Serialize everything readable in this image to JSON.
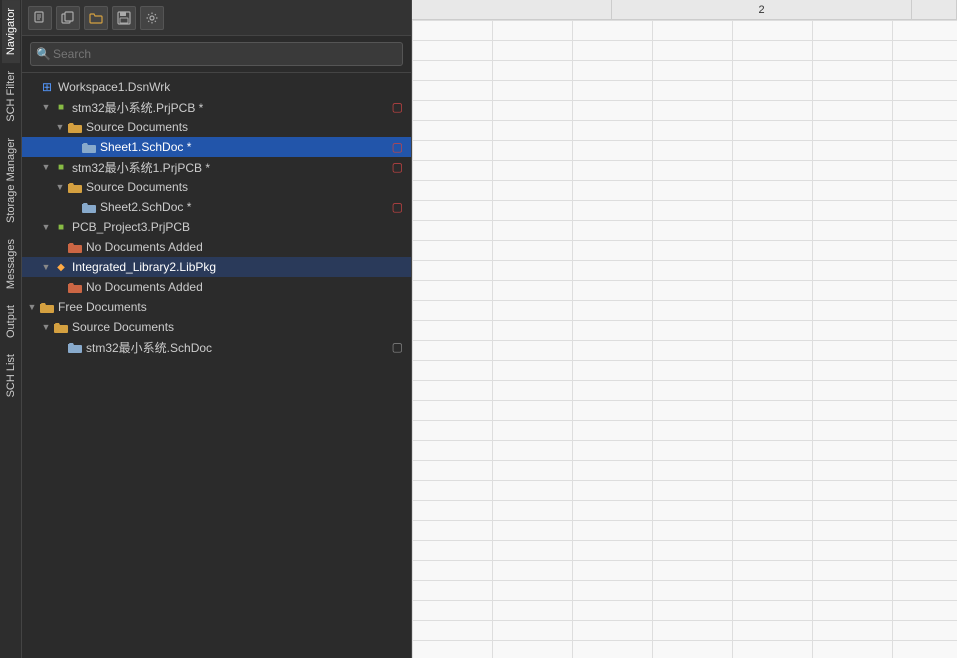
{
  "left_vtabs": [
    {
      "id": "navigator",
      "label": "Navigator"
    },
    {
      "id": "sch-filter",
      "label": "SCH Filter"
    },
    {
      "id": "storage-manager",
      "label": "Storage Manager"
    },
    {
      "id": "messages",
      "label": "Messages"
    },
    {
      "id": "output",
      "label": "Output"
    },
    {
      "id": "sch-list",
      "label": "SCH List"
    }
  ],
  "toolbar": {
    "buttons": [
      {
        "id": "btn1",
        "icon": "⊞",
        "tooltip": "New"
      },
      {
        "id": "btn2",
        "icon": "⧉",
        "tooltip": "Copy"
      },
      {
        "id": "btn3",
        "icon": "📂",
        "tooltip": "Open"
      },
      {
        "id": "btn4",
        "icon": "💾",
        "tooltip": "Save"
      },
      {
        "id": "btn5",
        "icon": "⚙",
        "tooltip": "Settings"
      }
    ]
  },
  "search": {
    "placeholder": "Search"
  },
  "tree": {
    "items": [
      {
        "id": "workspace",
        "level": 0,
        "type": "workspace",
        "label": "Workspace1.DsnWrk",
        "arrow": "empty",
        "modified": false
      },
      {
        "id": "proj1",
        "level": 1,
        "type": "project",
        "label": "stm32最小系统.PrjPCB *",
        "arrow": "expanded",
        "modified": true
      },
      {
        "id": "proj1-src",
        "level": 2,
        "type": "folder",
        "label": "Source Documents",
        "arrow": "expanded",
        "modified": false
      },
      {
        "id": "proj1-sheet1",
        "level": 3,
        "type": "schdoc",
        "label": "Sheet1.SchDoc *",
        "arrow": "empty",
        "modified": true,
        "selected": true
      },
      {
        "id": "proj2",
        "level": 1,
        "type": "project",
        "label": "stm32最小系统1.PrjPCB *",
        "arrow": "expanded",
        "modified": true
      },
      {
        "id": "proj2-src",
        "level": 2,
        "type": "folder",
        "label": "Source Documents",
        "arrow": "expanded",
        "modified": false
      },
      {
        "id": "proj2-sheet2",
        "level": 3,
        "type": "schdoc",
        "label": "Sheet2.SchDoc *",
        "arrow": "empty",
        "modified": true
      },
      {
        "id": "proj3",
        "level": 1,
        "type": "project-pcb",
        "label": "PCB_Project3.PrjPCB",
        "arrow": "expanded",
        "modified": false
      },
      {
        "id": "proj3-nodocs",
        "level": 2,
        "type": "nodocs",
        "label": "No Documents Added",
        "arrow": "empty",
        "modified": false
      },
      {
        "id": "libpkg",
        "level": 1,
        "type": "libpkg",
        "label": "Integrated_Library2.LibPkg",
        "arrow": "expanded",
        "modified": false,
        "highlighted": true
      },
      {
        "id": "libpkg-nodocs",
        "level": 2,
        "type": "nodocs",
        "label": "No Documents Added",
        "arrow": "empty",
        "modified": false
      },
      {
        "id": "freedocs",
        "level": 0,
        "type": "freedocs",
        "label": "Free Documents",
        "arrow": "expanded",
        "modified": false
      },
      {
        "id": "freedocs-src",
        "level": 1,
        "type": "folder",
        "label": "Source Documents",
        "arrow": "expanded",
        "modified": false
      },
      {
        "id": "freedocs-stm32",
        "level": 2,
        "type": "schdoc",
        "label": "stm32最小系统.SchDoc",
        "arrow": "empty",
        "modified": false,
        "modified_gray": true
      }
    ]
  },
  "content_header": {
    "col1": "",
    "col2": "2",
    "col3": ""
  }
}
